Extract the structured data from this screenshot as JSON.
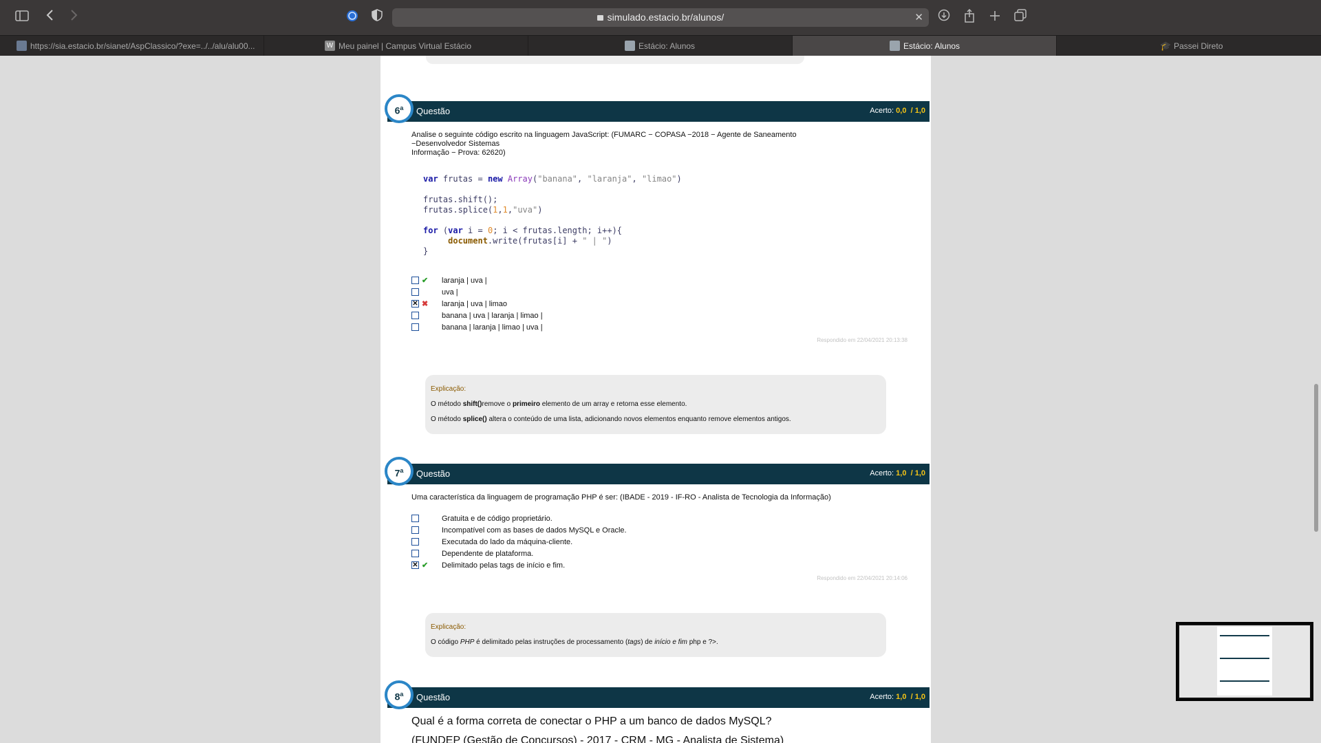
{
  "browser": {
    "url": "simulado.estacio.br/alunos/",
    "tabs": [
      {
        "label": "https://sia.estacio.br/sianet/AspClassico/?exe=../../alu/alu00...",
        "active": false
      },
      {
        "label": "Meu painel | Campus Virtual Estácio",
        "active": false
      },
      {
        "label": "Estácio: Alunos",
        "active": false
      },
      {
        "label": "Estácio: Alunos",
        "active": true
      },
      {
        "label": "Passei Direto",
        "active": false
      }
    ]
  },
  "questions": {
    "q6": {
      "number": "6",
      "suffix": "a",
      "title": "Questão",
      "score_label": "Acerto:",
      "score": "0,0",
      "max": "/ 1,0",
      "text_line1": "Analise o seguinte código escrito na linguagem JavaScript: (FUMARC − COPASA −2018 − Agente de Saneamento",
      "text_line2": "−Desenvolvedor Sistemas",
      "text_line3": "Informação − Prova: 62620)",
      "options": [
        {
          "label": "laranja | uva |",
          "checked": false,
          "mark": "✔"
        },
        {
          "label": "uva |",
          "checked": false,
          "mark": ""
        },
        {
          "label": "laranja | uva | limao",
          "checked": true,
          "mark": "✖"
        },
        {
          "label": "banana | uva | laranja | limao |",
          "checked": false,
          "mark": ""
        },
        {
          "label": "banana | laranja | limao | uva |",
          "checked": false,
          "mark": ""
        }
      ],
      "answered": "Respondido em 22/04/2021 20:13:38",
      "expl_title": "Explicação:",
      "expl_line1_pre": "O método ",
      "expl_line1_b1": "shift()",
      "expl_line1_mid": "remove o ",
      "expl_line1_b2": "primeiro",
      "expl_line1_post": " elemento de um array e retorna esse elemento.",
      "expl_line2_pre": "O método ",
      "expl_line2_b1": "splice()",
      "expl_line2_post": " altera o conteúdo de uma lista, adicionando novos elementos enquanto remove elementos antigos."
    },
    "q7": {
      "number": "7",
      "suffix": "a",
      "title": "Questão",
      "score_label": "Acerto:",
      "score": "1,0",
      "max": "/ 1,0",
      "text": "Uma característica da linguagem de programação PHP é ser: (IBADE - 2019 - IF-RO - Analista de Tecnologia da Informação)",
      "options": [
        {
          "label": "Gratuita e de código proprietário.",
          "checked": false,
          "mark": ""
        },
        {
          "label": "Incompatível com as bases de dados MySQL e Oracle.",
          "checked": false,
          "mark": ""
        },
        {
          "label": "Executada do lado da máquina-cliente.",
          "checked": false,
          "mark": ""
        },
        {
          "label": "Dependente de plataforma.",
          "checked": false,
          "mark": ""
        },
        {
          "label": "Delimitado pelas tags de início e fim.",
          "checked": true,
          "mark": "✔"
        }
      ],
      "answered": "Respondido em 22/04/2021 20:14:06",
      "expl_title": "Explicação:",
      "expl_pre": "O código ",
      "expl_i1": "PHP",
      "expl_mid1": " é delimitado pelas instruções de processamento (",
      "expl_i2": "tags",
      "expl_mid2": ") de ",
      "expl_i3": "início e fim",
      "expl_post": " php e ?>."
    },
    "q8": {
      "number": "8",
      "suffix": "a",
      "title": "Questão",
      "score_label": "Acerto:",
      "score": "1,0",
      "max": "/ 1,0",
      "text_line1": "Qual é a forma correta de conectar o PHP a um banco de dados MySQL?",
      "text_line2": "(FUNDEP (Gestão de Concursos) - 2017 - CRM - MG - Analista de Sistema)"
    }
  }
}
